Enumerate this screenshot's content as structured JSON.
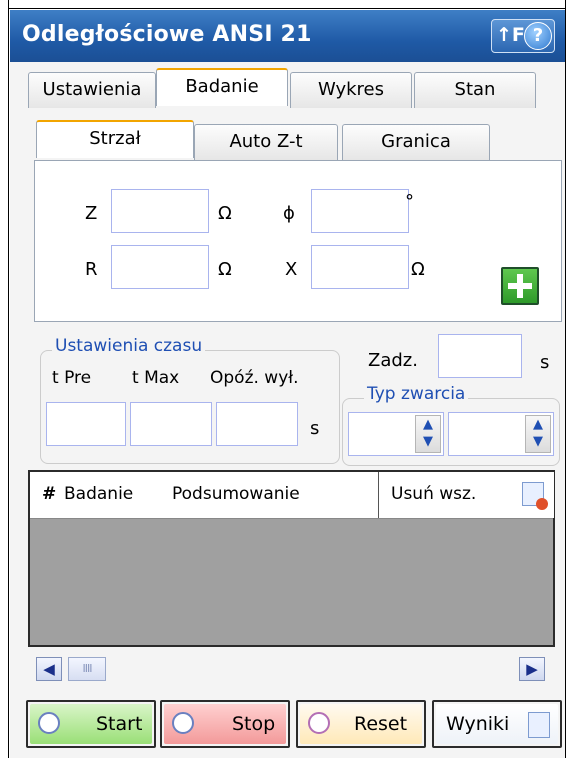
{
  "window": {
    "title": "Odległościowe ANSI 21",
    "f1_label": "↑F1",
    "help_glyph": "?"
  },
  "tabs": [
    "Ustawienia",
    "Badanie",
    "Wykres",
    "Stan"
  ],
  "subtabs": [
    "Strzał",
    "Auto Z-t",
    "Granica"
  ],
  "inputs": {
    "z_label": "Z",
    "phi_label": "ϕ",
    "r_label": "R",
    "x_label": "X",
    "ohm": "Ω",
    "degree": "°",
    "z_value": "",
    "phi_value": "",
    "r_value": "",
    "x_value": ""
  },
  "timing": {
    "group_title": "Ustawienia czasu",
    "t_pre": "t Pre",
    "t_max": "t Max",
    "delay": "Opóź. wył.",
    "unit": "s",
    "zadz_label": "Zadz.",
    "zadz_unit": "s",
    "fault_group_title": "Typ zwarcia"
  },
  "results_list": {
    "col_num": "#",
    "col_test": "Badanie",
    "col_summary": "Podsumowanie",
    "delete_all": "Usuń wsz.",
    "rows": []
  },
  "scrollbar": {
    "left": "◀",
    "right": "▶",
    "thumb": "IIII"
  },
  "buttons": {
    "start": "Start",
    "stop": "Stop",
    "reset": "Reset",
    "results": "Wyniki"
  }
}
